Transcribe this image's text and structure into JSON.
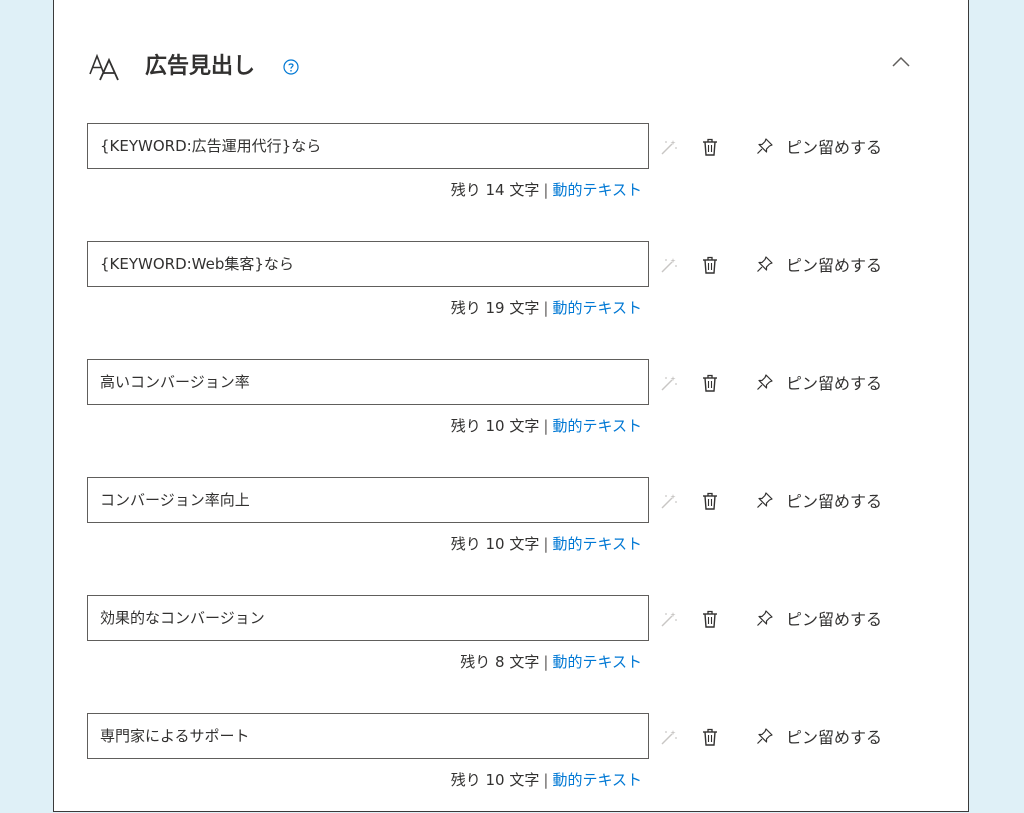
{
  "section": {
    "title": "広告見出し",
    "icons": {
      "heading": "font-size-icon",
      "help": "help-circle-icon",
      "collapse": "chevron-up-icon"
    }
  },
  "headlines": [
    {
      "text": "{KEYWORD:広告運用代行}なら",
      "remaining": "残り 14 文字",
      "dynamic_link": "動的テキスト",
      "pin_label": "ピン留めする"
    },
    {
      "text": "{KEYWORD:Web集客}なら",
      "remaining": "残り 19 文字",
      "dynamic_link": "動的テキスト",
      "pin_label": "ピン留めする"
    },
    {
      "text": "高いコンバージョン率",
      "remaining": "残り 10 文字",
      "dynamic_link": "動的テキスト",
      "pin_label": "ピン留めする"
    },
    {
      "text": "コンバージョン率向上",
      "remaining": "残り 10 文字",
      "dynamic_link": "動的テキスト",
      "pin_label": "ピン留めする"
    },
    {
      "text": "効果的なコンバージョン",
      "remaining": "残り 8 文字",
      "dynamic_link": "動的テキスト",
      "pin_label": "ピン留めする"
    },
    {
      "text": "専門家によるサポート",
      "remaining": "残り 10 文字",
      "dynamic_link": "動的テキスト",
      "pin_label": "ピン留めする"
    }
  ],
  "row_icons": {
    "suggest": "magic-wand-icon",
    "delete": "trash-icon",
    "pin": "pin-icon"
  },
  "colors": {
    "background": "#dff0f7",
    "link": "#0078d4",
    "text": "#323130",
    "border": "#605e5c"
  }
}
